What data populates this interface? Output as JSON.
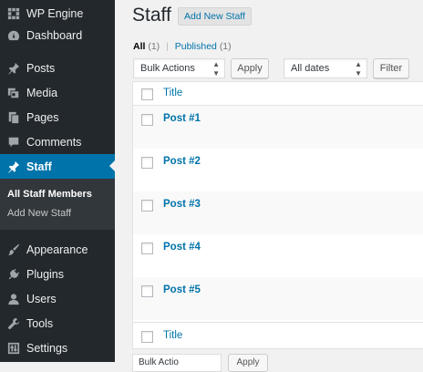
{
  "sidebar": {
    "top_items": [
      {
        "label": "WP Engine",
        "icon": "grid-icon"
      },
      {
        "label": "Dashboard",
        "icon": "gauge-icon"
      },
      {
        "label": "Posts",
        "icon": "pushpin-icon"
      },
      {
        "label": "Media",
        "icon": "media-icon"
      },
      {
        "label": "Pages",
        "icon": "pages-icon"
      },
      {
        "label": "Comments",
        "icon": "comment-icon"
      },
      {
        "label": "Staff",
        "icon": "pushpin-icon"
      }
    ],
    "submenu": {
      "all_label": "All Staff Members",
      "add_label": "Add New Staff"
    },
    "bottom_items": [
      {
        "label": "Appearance",
        "icon": "brush-icon"
      },
      {
        "label": "Plugins",
        "icon": "plug-icon"
      },
      {
        "label": "Users",
        "icon": "user-icon"
      },
      {
        "label": "Tools",
        "icon": "wrench-icon"
      },
      {
        "label": "Settings",
        "icon": "settings-icon"
      }
    ],
    "colors": {
      "background": "#23282d",
      "current": "#0073aa",
      "submenu": "#32373c"
    }
  },
  "header": {
    "title": "Staff",
    "add_new_label": "Add New Staff"
  },
  "views": {
    "all_label": "All",
    "all_count": "(1)",
    "separator": "|",
    "published_label": "Published",
    "published_count": "(1)"
  },
  "tablenav": {
    "bulk_actions": "Bulk Actions",
    "apply_label": "Apply",
    "dates": "All dates",
    "filter_label": "Filter"
  },
  "table": {
    "column_title": "Title",
    "rows": [
      {
        "title": "Post #1"
      },
      {
        "title": "Post #2"
      },
      {
        "title": "Post #3"
      },
      {
        "title": "Post #4"
      },
      {
        "title": "Post #5"
      }
    ],
    "footer_title": "Title"
  },
  "bottom_nav": {
    "bulk_actions": "Bulk Actio",
    "apply_label": "Apply"
  },
  "colors": {
    "link": "#0073aa",
    "page_bg": "#f1f1f1"
  }
}
